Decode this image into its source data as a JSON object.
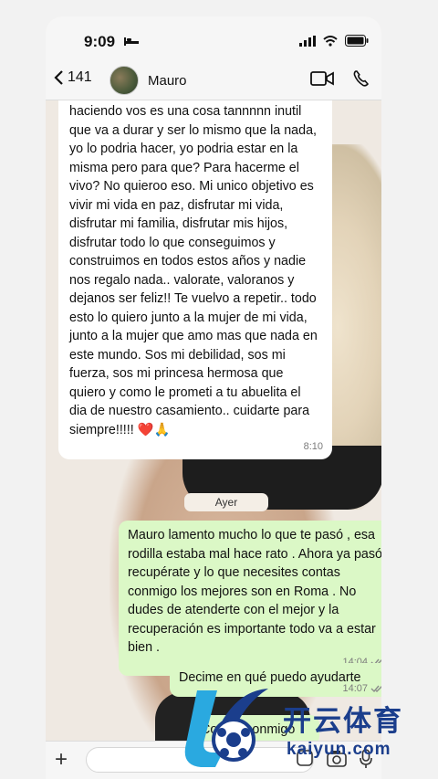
{
  "status_bar": {
    "time": "9:09"
  },
  "header": {
    "back_count": "141",
    "contact_name": "Mauro"
  },
  "messages": {
    "incoming": {
      "text": "haciendo vos es una cosa tannnnn inutil que va a durar y ser lo mismo que la nada, yo lo podria hacer, yo podria estar en la misma pero para que? Para hacerme el vivo? No quieroo eso. Mi unico objetivo es vivir mi vida en paz, disfrutar mi vida, disfrutar mi familia, disfrutar mis hijos, disfrutar todo lo que conseguimos y construimos en todos estos años y nadie nos regalo nada.. valorate, valoranos y dejanos ser feliz!! Te vuelvo a repetir.. todo esto lo quiero junto a la mujer de mi vida, junto a la mujer que amo mas que nada en este mundo. Sos mi debilidad, sos mi fuerza, sos mi princesa hermosa que quiero y como le prometi a tu abuelita el dia de nuestro casamiento.. cuidarte para siempre!!!!! ❤️🙏",
      "time": "8:10"
    },
    "date_separator": "Ayer",
    "outgoing_1": {
      "text": "Mauro lamento mucho lo que te pasó , esa rodilla estaba mal hace rato . Ahora ya pasó recupérate y lo que necesites contas conmigo los mejores son en Roma . No dudes de atenderte con el mejor y la recuperación es importante todo va a estar bien .",
      "time": "14:04"
    },
    "outgoing_2": {
      "text": "Decime en qué puedo ayudarte",
      "time": "14:07"
    },
    "outgoing_3": {
      "text": "Contas conmigo"
    }
  },
  "watermark": {
    "chinese": "开云体育",
    "latin": "kaiyun.com"
  },
  "colors": {
    "outgoing_bubble": "#dbf8c6",
    "incoming_bubble": "#ffffff",
    "watermark": "#1b3e8c",
    "watermark_accent": "#2aa9e0"
  },
  "icons": [
    "battery-icon",
    "bed-icon",
    "signal-icon",
    "wifi-icon",
    "back-chevron-icon",
    "video-call-icon",
    "phone-icon",
    "plus-icon",
    "sticker-icon",
    "camera-icon",
    "microphone-icon",
    "double-check-icon"
  ]
}
